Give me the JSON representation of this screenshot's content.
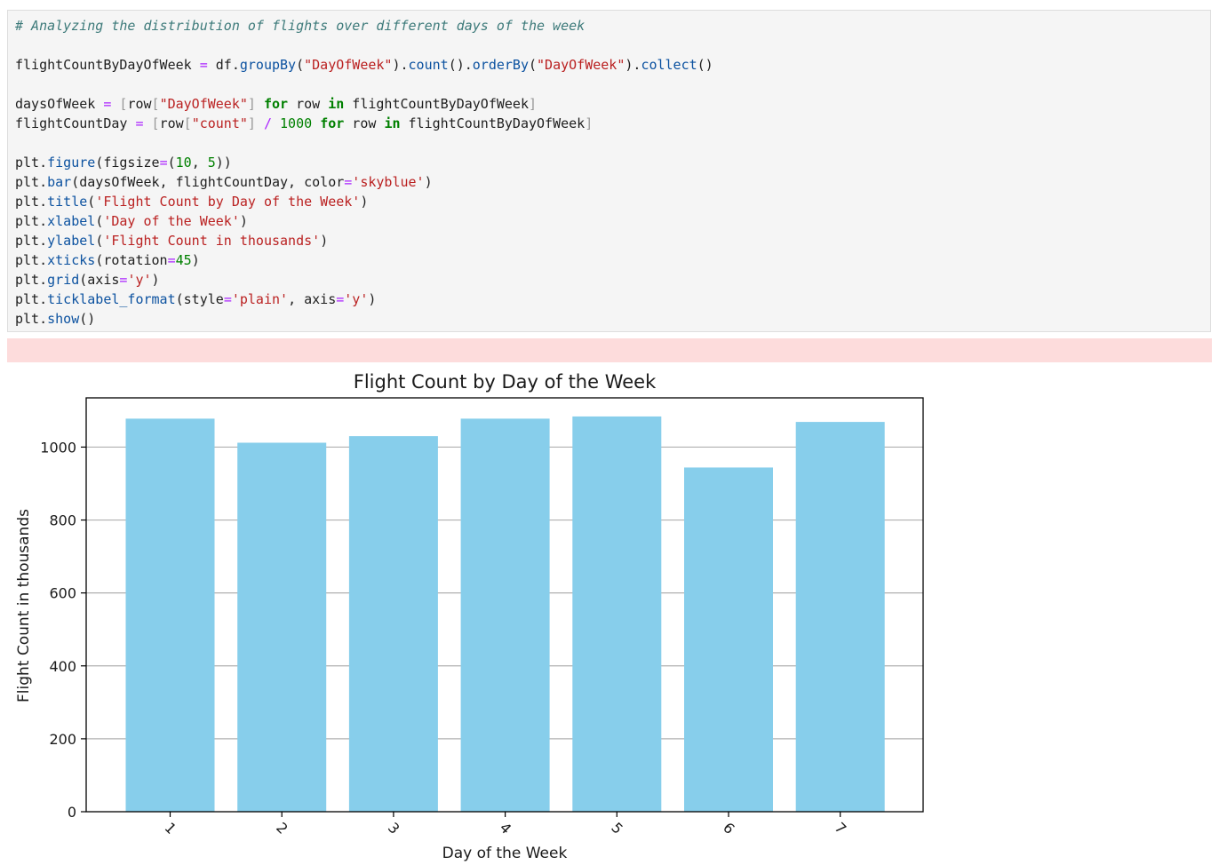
{
  "code_cell": {
    "lines": [
      [
        {
          "t": "# Analyzing the distribution of flights over different days of the week",
          "c": "comment"
        }
      ],
      [],
      [
        {
          "t": "flightCountByDayOfWeek ",
          "c": ""
        },
        {
          "t": "=",
          "c": "op"
        },
        {
          "t": " df.",
          "c": ""
        },
        {
          "t": "groupBy",
          "c": "fn"
        },
        {
          "t": "(",
          "c": ""
        },
        {
          "t": "\"DayOfWeek\"",
          "c": "str"
        },
        {
          "t": ").",
          "c": ""
        },
        {
          "t": "count",
          "c": "fn"
        },
        {
          "t": "().",
          "c": ""
        },
        {
          "t": "orderBy",
          "c": "fn"
        },
        {
          "t": "(",
          "c": ""
        },
        {
          "t": "\"DayOfWeek\"",
          "c": "str"
        },
        {
          "t": ").",
          "c": ""
        },
        {
          "t": "collect",
          "c": "fn"
        },
        {
          "t": "()",
          "c": ""
        }
      ],
      [],
      [
        {
          "t": "daysOfWeek ",
          "c": ""
        },
        {
          "t": "=",
          "c": "op"
        },
        {
          "t": " ",
          "c": ""
        },
        {
          "t": "[",
          "c": "br"
        },
        {
          "t": "row",
          "c": ""
        },
        {
          "t": "[",
          "c": "br"
        },
        {
          "t": "\"DayOfWeek\"",
          "c": "str"
        },
        {
          "t": "]",
          "c": "br"
        },
        {
          "t": " ",
          "c": ""
        },
        {
          "t": "for",
          "c": "kw"
        },
        {
          "t": " row ",
          "c": ""
        },
        {
          "t": "in",
          "c": "kw"
        },
        {
          "t": " flightCountByDayOfWeek",
          "c": ""
        },
        {
          "t": "]",
          "c": "br"
        }
      ],
      [
        {
          "t": "flightCountDay ",
          "c": ""
        },
        {
          "t": "=",
          "c": "op"
        },
        {
          "t": " ",
          "c": ""
        },
        {
          "t": "[",
          "c": "br"
        },
        {
          "t": "row",
          "c": ""
        },
        {
          "t": "[",
          "c": "br"
        },
        {
          "t": "\"count\"",
          "c": "str"
        },
        {
          "t": "]",
          "c": "br"
        },
        {
          "t": " ",
          "c": ""
        },
        {
          "t": "/",
          "c": "op"
        },
        {
          "t": " ",
          "c": ""
        },
        {
          "t": "1000",
          "c": "num"
        },
        {
          "t": " ",
          "c": ""
        },
        {
          "t": "for",
          "c": "kw"
        },
        {
          "t": " row ",
          "c": ""
        },
        {
          "t": "in",
          "c": "kw"
        },
        {
          "t": " flightCountByDayOfWeek",
          "c": ""
        },
        {
          "t": "]",
          "c": "br"
        }
      ],
      [],
      [
        {
          "t": "plt.",
          "c": ""
        },
        {
          "t": "figure",
          "c": "fn"
        },
        {
          "t": "(figsize",
          "c": ""
        },
        {
          "t": "=",
          "c": "op"
        },
        {
          "t": "(",
          "c": ""
        },
        {
          "t": "10",
          "c": "num"
        },
        {
          "t": ", ",
          "c": ""
        },
        {
          "t": "5",
          "c": "num"
        },
        {
          "t": "))",
          "c": ""
        }
      ],
      [
        {
          "t": "plt.",
          "c": ""
        },
        {
          "t": "bar",
          "c": "fn"
        },
        {
          "t": "(daysOfWeek, flightCountDay, color",
          "c": ""
        },
        {
          "t": "=",
          "c": "op"
        },
        {
          "t": "'skyblue'",
          "c": "str"
        },
        {
          "t": ")",
          "c": ""
        }
      ],
      [
        {
          "t": "plt.",
          "c": ""
        },
        {
          "t": "title",
          "c": "fn"
        },
        {
          "t": "(",
          "c": ""
        },
        {
          "t": "'Flight Count by Day of the Week'",
          "c": "str"
        },
        {
          "t": ")",
          "c": ""
        }
      ],
      [
        {
          "t": "plt.",
          "c": ""
        },
        {
          "t": "xlabel",
          "c": "fn"
        },
        {
          "t": "(",
          "c": ""
        },
        {
          "t": "'Day of the Week'",
          "c": "str"
        },
        {
          "t": ")",
          "c": ""
        }
      ],
      [
        {
          "t": "plt.",
          "c": ""
        },
        {
          "t": "ylabel",
          "c": "fn"
        },
        {
          "t": "(",
          "c": ""
        },
        {
          "t": "'Flight Count in thousands'",
          "c": "str"
        },
        {
          "t": ")",
          "c": ""
        }
      ],
      [
        {
          "t": "plt.",
          "c": ""
        },
        {
          "t": "xticks",
          "c": "fn"
        },
        {
          "t": "(rotation",
          "c": ""
        },
        {
          "t": "=",
          "c": "op"
        },
        {
          "t": "45",
          "c": "num"
        },
        {
          "t": ")",
          "c": ""
        }
      ],
      [
        {
          "t": "plt.",
          "c": ""
        },
        {
          "t": "grid",
          "c": "fn"
        },
        {
          "t": "(axis",
          "c": ""
        },
        {
          "t": "=",
          "c": "op"
        },
        {
          "t": "'y'",
          "c": "str"
        },
        {
          "t": ")",
          "c": ""
        }
      ],
      [
        {
          "t": "plt.",
          "c": ""
        },
        {
          "t": "ticklabel_format",
          "c": "fn"
        },
        {
          "t": "(style",
          "c": ""
        },
        {
          "t": "=",
          "c": "op"
        },
        {
          "t": "'plain'",
          "c": "str"
        },
        {
          "t": ", axis",
          "c": ""
        },
        {
          "t": "=",
          "c": "op"
        },
        {
          "t": "'y'",
          "c": "str"
        },
        {
          "t": ")",
          "c": ""
        }
      ],
      [
        {
          "t": "plt.",
          "c": ""
        },
        {
          "t": "show",
          "c": "fn"
        },
        {
          "t": "()",
          "c": ""
        }
      ]
    ]
  },
  "colors": {
    "bar": "#87ceeb",
    "grid": "#b0b0b0",
    "axis": "#000000",
    "stderr_bg": "#fddcdc"
  },
  "chart_data": {
    "type": "bar",
    "title": "Flight Count by Day of the Week",
    "xlabel": "Day of the Week",
    "ylabel": "Flight Count in thousands",
    "categories": [
      "1",
      "2",
      "3",
      "4",
      "5",
      "6",
      "7"
    ],
    "values": [
      1078,
      1012,
      1030,
      1078,
      1084,
      944,
      1069
    ],
    "ylim": [
      0,
      1135
    ],
    "yticks": [
      0,
      200,
      400,
      600,
      800,
      1000
    ],
    "xtick_rotation": 45,
    "grid": "y",
    "legend": "none"
  }
}
